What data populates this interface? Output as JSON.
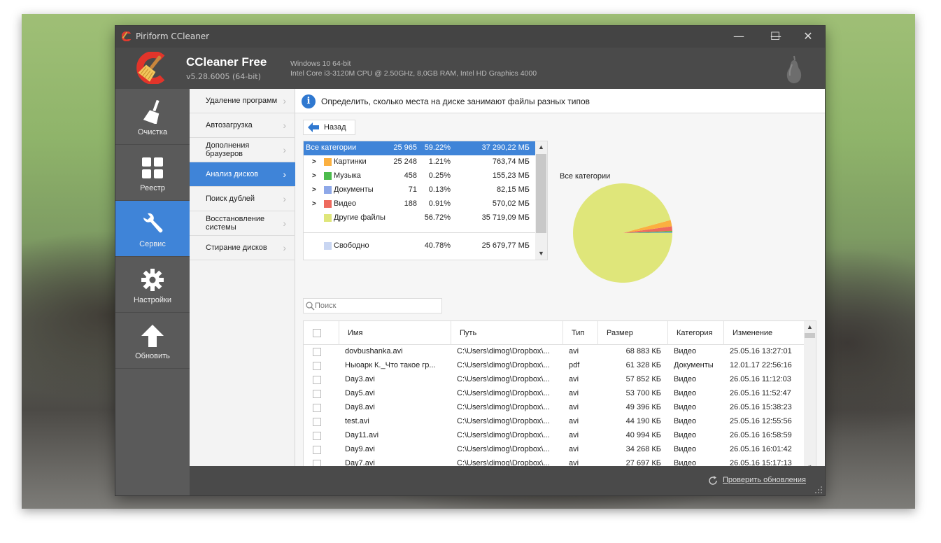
{
  "window": {
    "title": "Piriform CCleaner",
    "controls": {
      "minimize": "—",
      "maximize": "☐",
      "close": "✕"
    }
  },
  "header": {
    "product": "CCleaner Free",
    "version": "v5.28.6005 (64-bit)",
    "os": "Windows 10 64-bit",
    "hardware": "Intel Core i3-3120M CPU @ 2.50GHz, 8,0GB RAM, Intel HD Graphics 4000"
  },
  "leftnav": [
    {
      "label": "Очистка",
      "icon": "broom-icon"
    },
    {
      "label": "Реестр",
      "icon": "registry-grid-icon"
    },
    {
      "label": "Сервис",
      "icon": "wrench-icon",
      "active": true
    },
    {
      "label": "Настройки",
      "icon": "gear-icon"
    },
    {
      "label": "Обновить",
      "icon": "arrow-up-icon"
    }
  ],
  "subnav": [
    {
      "label": "Удаление программ"
    },
    {
      "label": "Автозагрузка"
    },
    {
      "label": "Дополнения браузеров"
    },
    {
      "label": "Анализ дисков",
      "active": true
    },
    {
      "label": "Поиск дублей"
    },
    {
      "label": "Восстановление системы"
    },
    {
      "label": "Стирание дисков"
    }
  ],
  "info": {
    "icon": "info-icon",
    "text": "Определить, сколько места на диске занимают файлы разных типов"
  },
  "back": {
    "label": "Назад"
  },
  "categories": {
    "rows": [
      {
        "name": "Все категории",
        "count": "25 965",
        "percent": "59.22%",
        "size": "37 290,22 МБ",
        "selected": true
      },
      {
        "name": "Картинки",
        "count": "25 248",
        "percent": "1.21%",
        "size": "763,74 МБ",
        "color": "#fbb040",
        "expand": ">"
      },
      {
        "name": "Музыка",
        "count": "458",
        "percent": "0.25%",
        "size": "155,23 МБ",
        "color": "#4cbb4c",
        "expand": ">"
      },
      {
        "name": "Документы",
        "count": "71",
        "percent": "0.13%",
        "size": "82,15 МБ",
        "color": "#8ea8e8",
        "expand": ">"
      },
      {
        "name": "Видео",
        "count": "188",
        "percent": "0.91%",
        "size": "570,02 МБ",
        "color": "#ee6a5e",
        "expand": ">"
      },
      {
        "name": "Другие файлы",
        "count": "",
        "percent": "56.72%",
        "size": "35 719,09 МБ",
        "color": "#dfe67a"
      },
      {
        "name": "Свободно",
        "count": "",
        "percent": "40.78%",
        "size": "25 679,77 МБ",
        "color": "#c9d6f2"
      }
    ]
  },
  "pie": {
    "title": "Все категории",
    "slices": [
      {
        "name": "Другие файлы",
        "value": 35719.09,
        "color": "#dfe67a"
      },
      {
        "name": "Картинки",
        "value": 763.74,
        "color": "#fbb040"
      },
      {
        "name": "Видео",
        "value": 570.02,
        "color": "#ee6a5e"
      },
      {
        "name": "Музыка",
        "value": 155.23,
        "color": "#4cbb4c"
      },
      {
        "name": "Документы",
        "value": 82.15,
        "color": "#8ea8e8"
      }
    ]
  },
  "search": {
    "placeholder": "Поиск"
  },
  "files": {
    "columns": [
      "Имя",
      "Путь",
      "Тип",
      "Размер",
      "Категория",
      "Изменение"
    ],
    "rows": [
      {
        "name": "dovbushanka.avi",
        "path": "C:\\Users\\dimog\\Dropbox\\...",
        "type": "avi",
        "size": "68 883 КБ",
        "category": "Видео",
        "modified": "25.05.16 13:27:01"
      },
      {
        "name": "Ньюарк К._Что такое гр...",
        "path": "C:\\Users\\dimog\\Dropbox\\...",
        "type": "pdf",
        "size": "61 328 КБ",
        "category": "Документы",
        "modified": "12.01.17 22:56:16"
      },
      {
        "name": "Day3.avi",
        "path": "C:\\Users\\dimog\\Dropbox\\...",
        "type": "avi",
        "size": "57 852 КБ",
        "category": "Видео",
        "modified": "26.05.16 11:12:03"
      },
      {
        "name": "Day5.avi",
        "path": "C:\\Users\\dimog\\Dropbox\\...",
        "type": "avi",
        "size": "53 700 КБ",
        "category": "Видео",
        "modified": "26.05.16 11:52:47"
      },
      {
        "name": "Day8.avi",
        "path": "C:\\Users\\dimog\\Dropbox\\...",
        "type": "avi",
        "size": "49 396 КБ",
        "category": "Видео",
        "modified": "26.05.16 15:38:23"
      },
      {
        "name": "test.avi",
        "path": "C:\\Users\\dimog\\Dropbox\\...",
        "type": "avi",
        "size": "44 190 КБ",
        "category": "Видео",
        "modified": "25.05.16 12:55:56"
      },
      {
        "name": "Day11.avi",
        "path": "C:\\Users\\dimog\\Dropbox\\...",
        "type": "avi",
        "size": "40 994 КБ",
        "category": "Видео",
        "modified": "26.05.16 16:58:59"
      },
      {
        "name": "Day9.avi",
        "path": "C:\\Users\\dimog\\Dropbox\\...",
        "type": "avi",
        "size": "34 268 КБ",
        "category": "Видео",
        "modified": "26.05.16 16:01:42"
      },
      {
        "name": "Day7.avi",
        "path": "C:\\Users\\dimog\\Dropbox\\...",
        "type": "avi",
        "size": "27 697 КБ",
        "category": "Видео",
        "modified": "26.05.16 15:17:13"
      }
    ]
  },
  "footer": {
    "update_label": "Проверить обновления"
  },
  "colors": {
    "accent": "#3f84d8",
    "chrome": "#4a4a4a",
    "nav": "#5a5a5a"
  }
}
